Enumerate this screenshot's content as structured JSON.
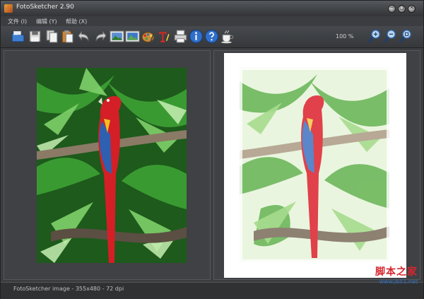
{
  "window": {
    "title": "FotoSketcher 2.90"
  },
  "menu": [
    {
      "label": "文件 (I)"
    },
    {
      "label": "编辑 (Y)"
    },
    {
      "label": "帮助 (X)"
    }
  ],
  "toolbar": {
    "zoom_level": "100 %",
    "icons": [
      "open-folder-icon",
      "save-icon",
      "copy-icon",
      "paste-icon",
      "undo-icon",
      "redo-icon",
      "show-original-icon",
      "show-sketch-icon",
      "palette-icon",
      "text-icon",
      "print-icon",
      "info-icon",
      "help-icon",
      "coffee-icon",
      "zoom-in-icon",
      "zoom-out-icon",
      "zoom-fit-icon"
    ]
  },
  "status": {
    "text": "FotoSketcher image - 355x480 - 72 dpi"
  },
  "watermark": {
    "main": "脚本之家",
    "sub": "www.jb51.net"
  },
  "colors": {
    "background": "#3b3d40",
    "parrot_red": "#d41f26",
    "foliage": "#2f8f2a"
  }
}
